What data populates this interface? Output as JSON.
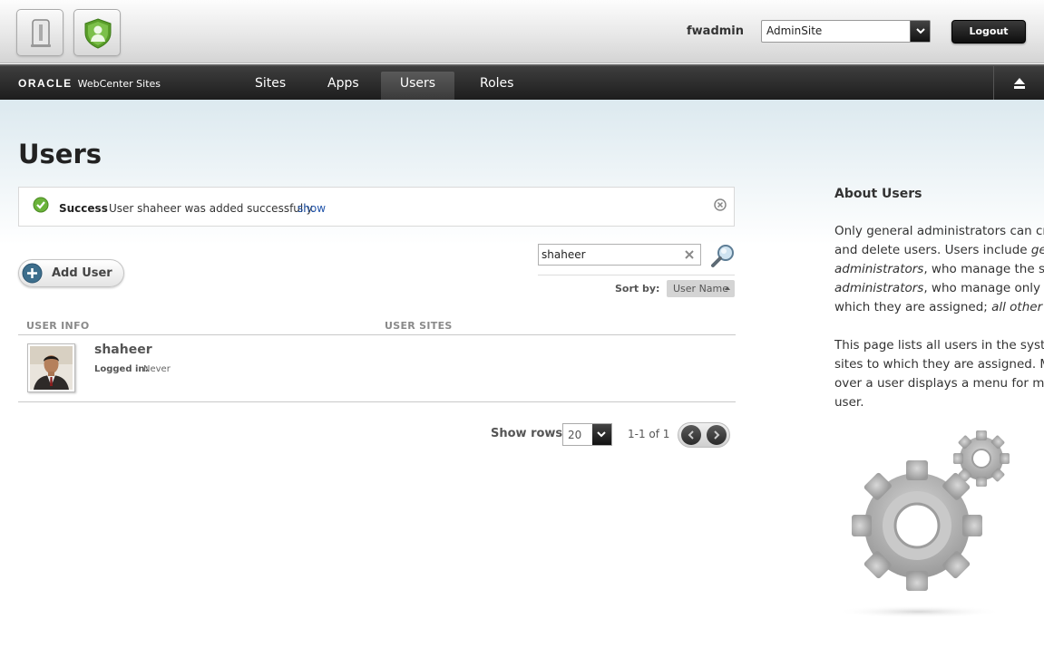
{
  "header": {
    "username": "fwadmin",
    "site_select": "AdminSite",
    "logout_label": "Logout"
  },
  "nav": {
    "brand_oracle": "ORACLE",
    "brand_product": "WebCenter Sites",
    "items": [
      {
        "label": "Sites",
        "active": false
      },
      {
        "label": "Apps",
        "active": false
      },
      {
        "label": "Users",
        "active": true
      },
      {
        "label": "Roles",
        "active": false
      }
    ]
  },
  "page": {
    "title": "Users"
  },
  "notification": {
    "label": "Success",
    "message": "User shaheer was added successfully.",
    "link": "show"
  },
  "toolbar": {
    "add_user_label": "Add User",
    "search_value": "shaheer",
    "sort_by_label": "Sort by:",
    "sort_value": "User Name"
  },
  "table": {
    "columns": [
      "USER INFO",
      "USER SITES"
    ],
    "rows": [
      {
        "name": "shaheer",
        "logged_in_label": "Logged in:",
        "logged_in_value": "Never"
      }
    ]
  },
  "pagination": {
    "show_rows_label": "Show rows:",
    "rows_value": "20",
    "range": "1-1 of 1"
  },
  "about": {
    "title": "About Users",
    "p1": [
      {
        "t": "Only general administrators can create"
      },
      {
        "t": "and delete users. Users include ",
        "em": "genera"
      },
      {
        "em": "administrators",
        "t": ", who manage the syste"
      },
      {
        "em": "administrators",
        "t": ", who manage only the"
      },
      {
        "t": "which they are assigned; ",
        "em": "all other user"
      }
    ],
    "p2": [
      "This page lists all users in the system a",
      "sites to which they are assigned. Mous",
      "over a user displays a menu for manag",
      "user."
    ]
  },
  "colors": {
    "link": "#2255aa",
    "success": "#5aa02c",
    "nav_bg": "#2a2a2a"
  }
}
